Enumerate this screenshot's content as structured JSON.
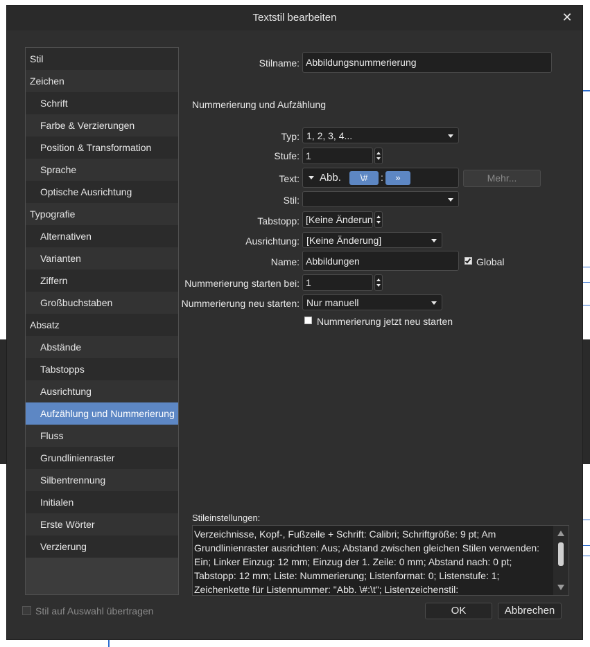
{
  "dialog": {
    "title": "Textstil bearbeiten",
    "close_glyph": "✕"
  },
  "sidebar": {
    "items": [
      {
        "label": "Stil",
        "level": 0
      },
      {
        "label": "Zeichen",
        "level": 0
      },
      {
        "label": "Schrift",
        "level": 1
      },
      {
        "label": "Farbe & Verzierungen",
        "level": 1
      },
      {
        "label": "Position & Transformation",
        "level": 1
      },
      {
        "label": "Sprache",
        "level": 1
      },
      {
        "label": "Optische Ausrichtung",
        "level": 1
      },
      {
        "label": "Typografie",
        "level": 0
      },
      {
        "label": "Alternativen",
        "level": 1
      },
      {
        "label": "Varianten",
        "level": 1
      },
      {
        "label": "Ziffern",
        "level": 1
      },
      {
        "label": "Großbuchstaben",
        "level": 1
      },
      {
        "label": "Absatz",
        "level": 0
      },
      {
        "label": "Abstände",
        "level": 1
      },
      {
        "label": "Tabstopps",
        "level": 1
      },
      {
        "label": "Ausrichtung",
        "level": 1
      },
      {
        "label": "Aufzählung und Nummerierung",
        "level": 1,
        "active": true
      },
      {
        "label": "Fluss",
        "level": 1
      },
      {
        "label": "Grundlinienraster",
        "level": 1
      },
      {
        "label": "Silbentrennung",
        "level": 1
      },
      {
        "label": "Initialen",
        "level": 1
      },
      {
        "label": "Erste Wörter",
        "level": 1
      },
      {
        "label": "Verzierung",
        "level": 1
      }
    ],
    "apply_style_label": "Stil auf Auswahl übertragen"
  },
  "form": {
    "stilname_label": "Stilname:",
    "stilname_value": "Abbildungsnummerierung",
    "section_title": "Nummerierung und Aufzählung",
    "typ_label": "Typ:",
    "typ_value": "1, 2, 3, 4...",
    "stufe_label": "Stufe:",
    "stufe_value": "1",
    "text_label": "Text:",
    "text_prefix": "Abb.",
    "token_number": "\\#",
    "text_separator": ":",
    "token_tab": "»",
    "mehr_label": "Mehr...",
    "stil_label": "Stil:",
    "stil_value": "",
    "tabstopp_label": "Tabstopp:",
    "tabstopp_value": "[Keine Änderung]",
    "ausrichtung_label": "Ausrichtung:",
    "ausrichtung_value": "[Keine Änderung]",
    "name_label": "Name:",
    "name_value": "Abbildungen",
    "global_label": "Global",
    "start_label": "Nummerierung starten bei:",
    "start_value": "1",
    "restart_label": "Nummerierung neu starten:",
    "restart_value": "Nur manuell",
    "restart_now_label": "Nummerierung jetzt neu starten"
  },
  "settings": {
    "label": "Stileinstellungen:",
    "text": "Verzeichnisse, Kopf-, Fußzeile + Schrift: Calibri; Schriftgröße: 9 pt; Am Grundlinienraster ausrichten: Aus; Abstand zwischen gleichen Stilen verwenden: Ein; Linker Einzug: 12 mm; Einzug der 1. Zeile: 0 mm; Abstand nach: 0 pt; Tabstopp: 12 mm; Liste: Nummerierung; Listenformat: 0; Listenstufe: 1; Zeichenkette für Listennummer: \"Abb. \\#:\\t\"; Listenzeichenstil:"
  },
  "buttons": {
    "ok": "OK",
    "cancel": "Abbrechen"
  },
  "colors": {
    "dialog_bg": "#2f2f2f",
    "accent": "#5d87c4"
  }
}
